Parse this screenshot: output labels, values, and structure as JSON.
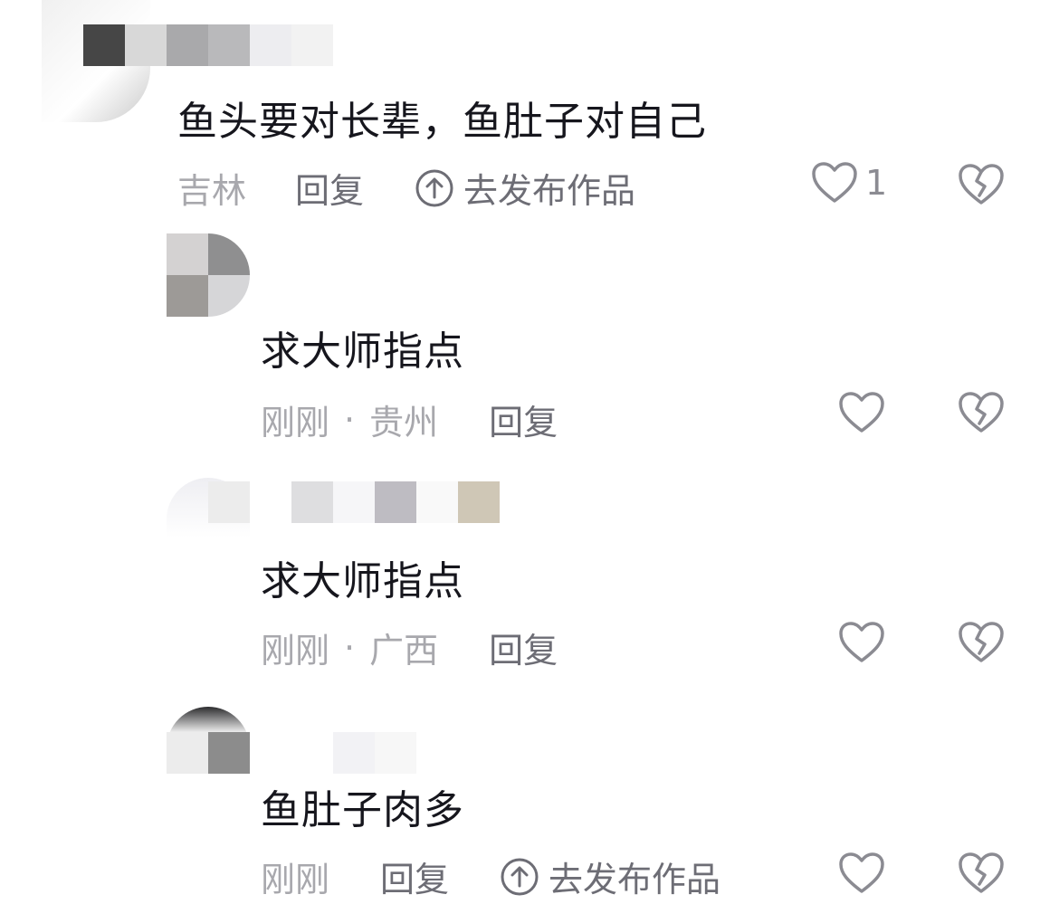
{
  "comments": [
    {
      "text": "鱼头要对长辈，鱼肚子对自己",
      "time": "",
      "location": "吉林",
      "reply_label": "回复",
      "publish_label": "去发布作品",
      "like_count": "1"
    },
    {
      "text": "求大师指点",
      "time": "刚刚",
      "separator": "·",
      "location": "贵州",
      "reply_label": "回复",
      "like_count": ""
    },
    {
      "text": "求大师指点",
      "time": "刚刚",
      "separator": "·",
      "location": "广西",
      "reply_label": "回复",
      "like_count": ""
    },
    {
      "text": "鱼肚子肉多",
      "time": "刚刚",
      "reply_label": "回复",
      "publish_label": "去发布作品",
      "like_count": ""
    }
  ],
  "icons": {
    "like": "heart-outline-icon",
    "dislike": "broken-heart-icon",
    "publish": "arrow-up-circle-icon"
  },
  "colors": {
    "text": "#16161d",
    "meta": "#a8a8ad",
    "action": "#6d6d75",
    "icon": "#8b8b92"
  }
}
